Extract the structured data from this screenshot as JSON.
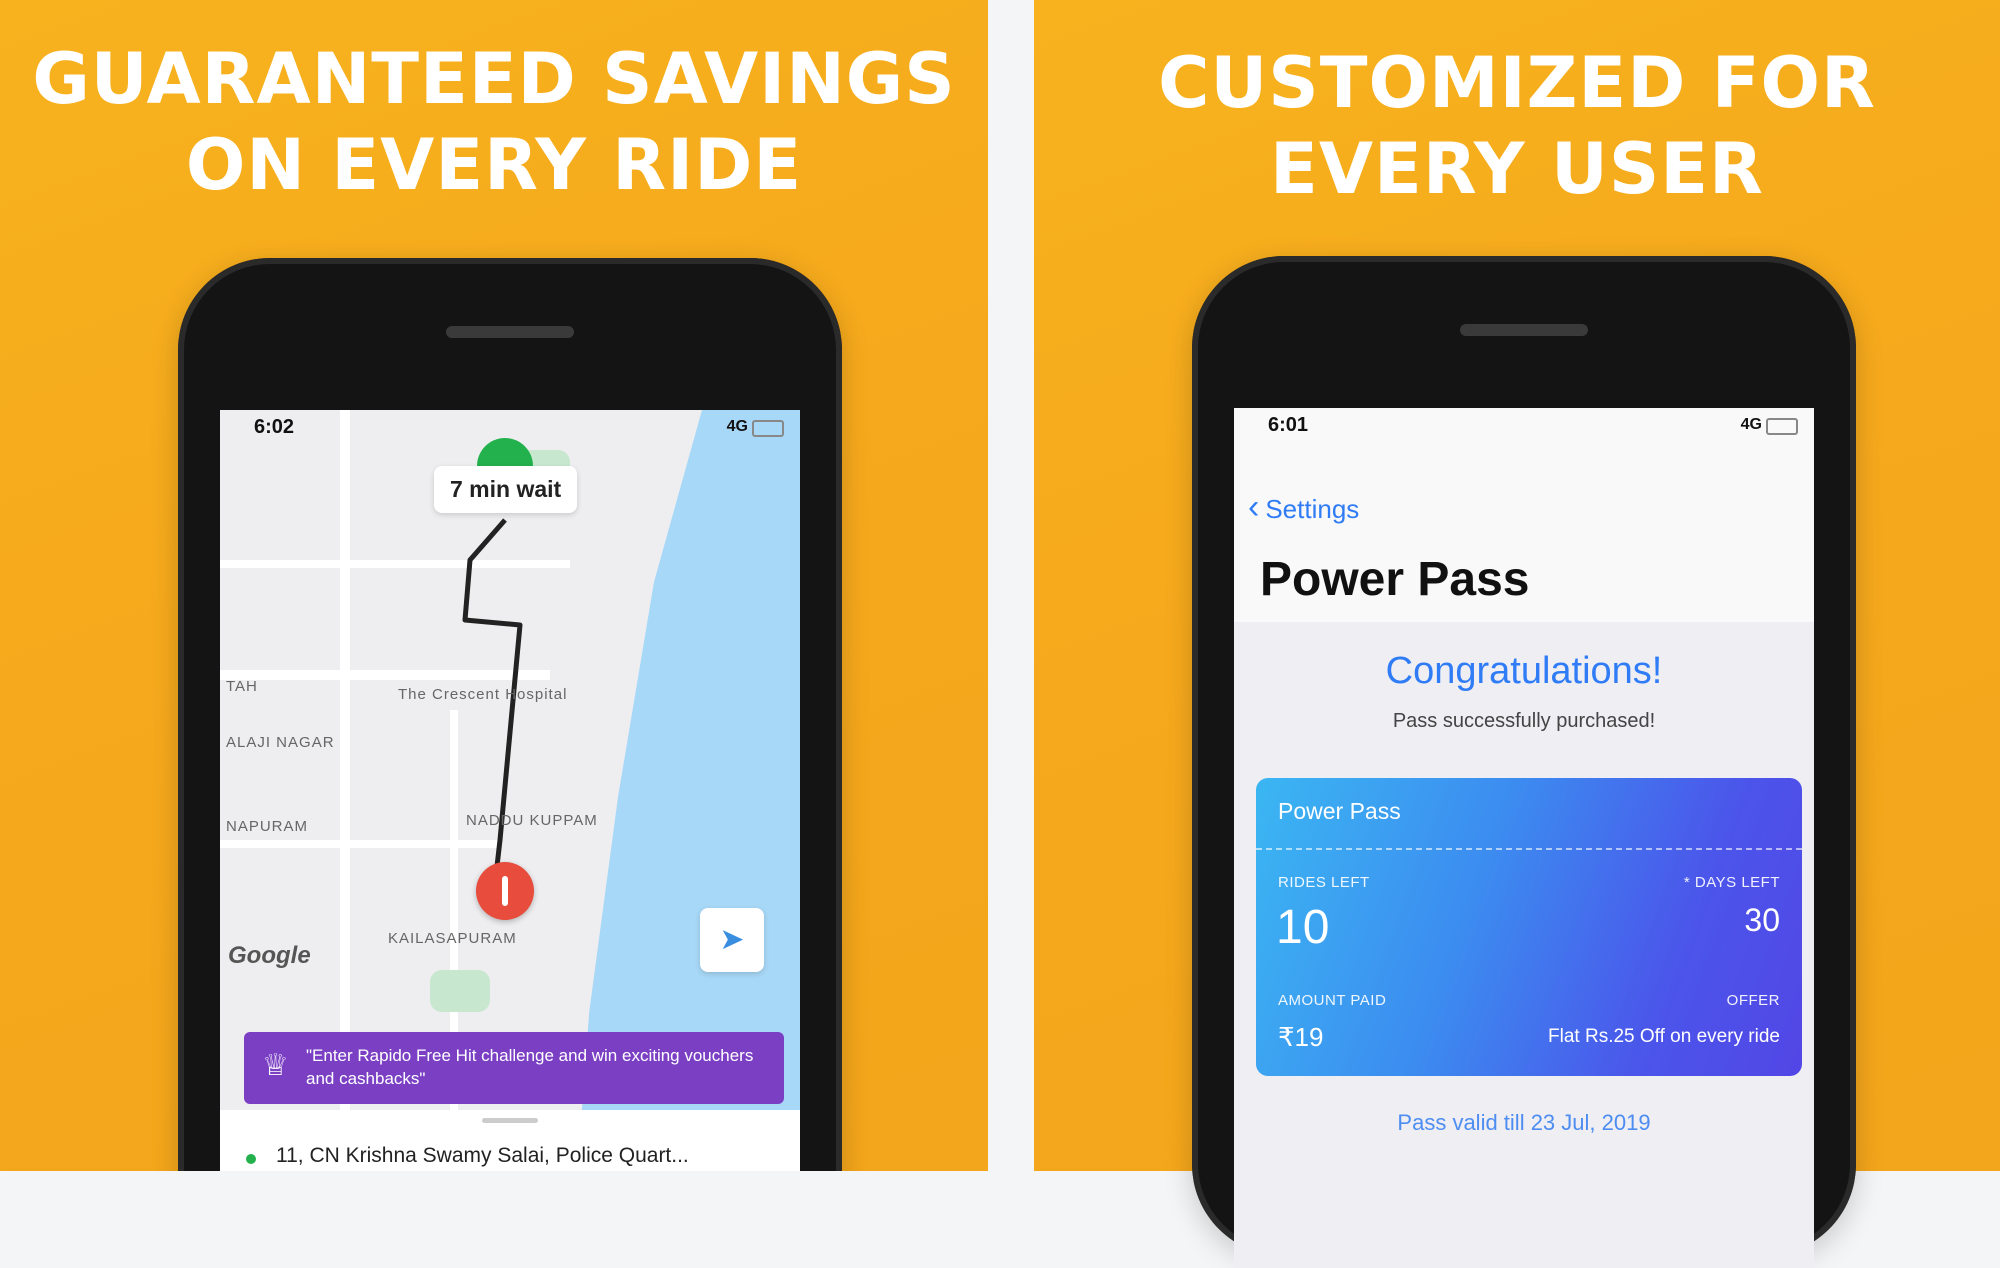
{
  "left_panel": {
    "headline_line1": "GUARANTEED SAVINGS",
    "headline_line2": "ON EVERY RIDE",
    "status": {
      "time": "6:02",
      "network": "4G"
    },
    "map": {
      "wait_label": "7 min wait",
      "labels": [
        "The Crescent Hospital",
        "ALAJI NAGAR",
        "NAPURAM",
        "NADDU KUPPAM",
        "KAILASAPURAM",
        "TAH"
      ],
      "google_logo": "Google"
    },
    "promo_text": "\"Enter Rapido Free Hit challenge and win exciting vouchers and cashbacks\"",
    "destination": "11, CN Krishna Swamy Salai, Police Quart..."
  },
  "right_panel": {
    "headline_line1": "CUSTOMIZED FOR",
    "headline_line2": "EVERY USER",
    "status": {
      "time": "6:01",
      "network": "4G"
    },
    "back_label": "Settings",
    "title": "Power Pass",
    "congrats": "Congratulations!",
    "purchased": "Pass successfully purchased!",
    "card": {
      "name": "Power Pass",
      "rides_left_label": "RIDES LEFT",
      "rides_left_value": "10",
      "days_left_label": "* DAYS LEFT",
      "days_left_value": "30",
      "amount_paid_label": "AMOUNT PAID",
      "amount_paid_value": "₹19",
      "offer_label": "OFFER",
      "offer_value": "Flat Rs.25 Off on every ride"
    },
    "valid_till": "Pass valid till 23 Jul, 2019"
  },
  "colors": {
    "background_yellow": "#f6a91c",
    "rapido_purple": "#7b3fc4",
    "ios_blue": "#2f7cf6",
    "pickup_green": "#22b14c",
    "drop_red": "#e74c3c"
  },
  "icons": [
    "navigation-arrow-icon",
    "back-chevron-icon",
    "wallet-icon",
    "location-pin-icon"
  ]
}
